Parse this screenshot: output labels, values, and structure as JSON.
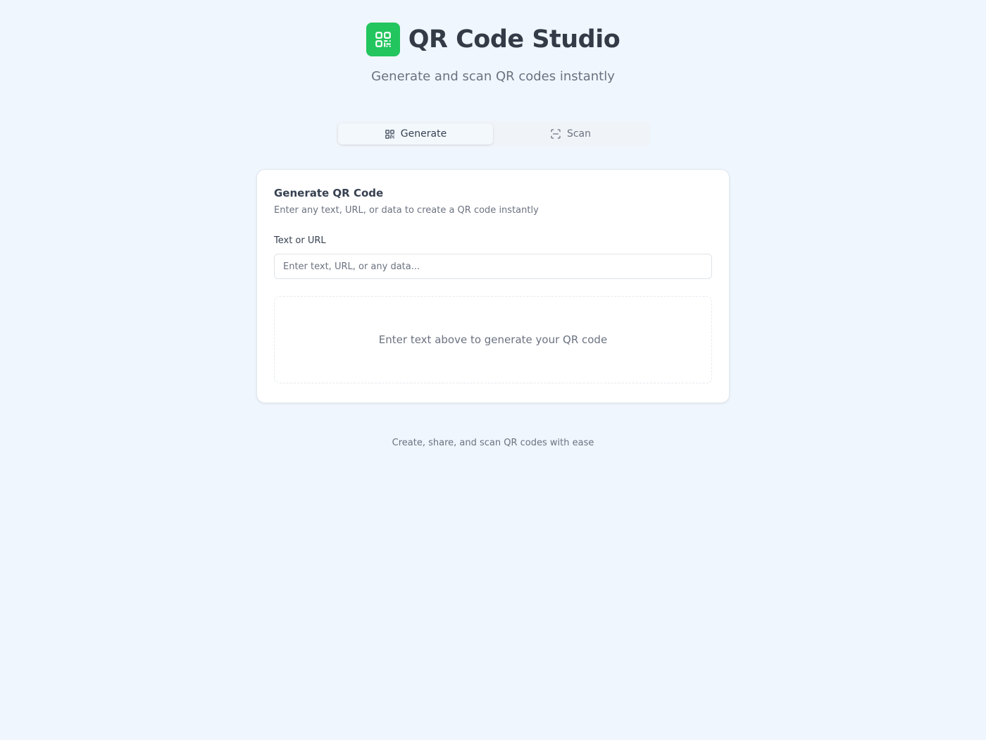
{
  "app": {
    "title": "QR Code Studio",
    "subtitle": "Generate and scan QR codes instantly",
    "logo_icon": "qr-code-icon",
    "accent_color": "#22c55e"
  },
  "tabs": [
    {
      "label": "Generate",
      "icon": "qr-code-icon",
      "active": true
    },
    {
      "label": "Scan",
      "icon": "scan-icon",
      "active": false
    }
  ],
  "generate_card": {
    "title": "Generate QR Code",
    "description": "Enter any text, URL, or data to create a QR code instantly",
    "field_label": "Text or URL",
    "input_value": "",
    "input_placeholder": "Enter text, URL, or any data...",
    "empty_message": "Enter text above to generate your QR code"
  },
  "footer": {
    "text": "Create, share, and scan QR codes with ease"
  }
}
